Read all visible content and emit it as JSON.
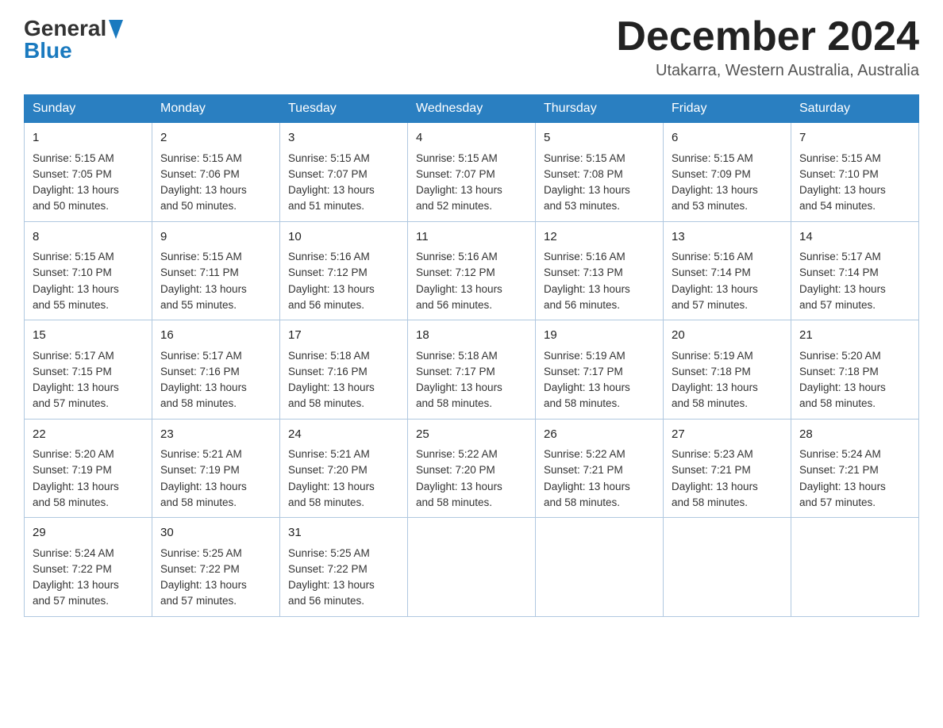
{
  "header": {
    "logo_general": "General",
    "logo_blue": "Blue",
    "month_title": "December 2024",
    "subtitle": "Utakarra, Western Australia, Australia"
  },
  "days_of_week": [
    "Sunday",
    "Monday",
    "Tuesday",
    "Wednesday",
    "Thursday",
    "Friday",
    "Saturday"
  ],
  "weeks": [
    {
      "days": [
        {
          "num": "1",
          "sunrise": "5:15 AM",
          "sunset": "7:05 PM",
          "daylight": "13 hours and 50 minutes."
        },
        {
          "num": "2",
          "sunrise": "5:15 AM",
          "sunset": "7:06 PM",
          "daylight": "13 hours and 50 minutes."
        },
        {
          "num": "3",
          "sunrise": "5:15 AM",
          "sunset": "7:07 PM",
          "daylight": "13 hours and 51 minutes."
        },
        {
          "num": "4",
          "sunrise": "5:15 AM",
          "sunset": "7:07 PM",
          "daylight": "13 hours and 52 minutes."
        },
        {
          "num": "5",
          "sunrise": "5:15 AM",
          "sunset": "7:08 PM",
          "daylight": "13 hours and 53 minutes."
        },
        {
          "num": "6",
          "sunrise": "5:15 AM",
          "sunset": "7:09 PM",
          "daylight": "13 hours and 53 minutes."
        },
        {
          "num": "7",
          "sunrise": "5:15 AM",
          "sunset": "7:10 PM",
          "daylight": "13 hours and 54 minutes."
        }
      ]
    },
    {
      "days": [
        {
          "num": "8",
          "sunrise": "5:15 AM",
          "sunset": "7:10 PM",
          "daylight": "13 hours and 55 minutes."
        },
        {
          "num": "9",
          "sunrise": "5:15 AM",
          "sunset": "7:11 PM",
          "daylight": "13 hours and 55 minutes."
        },
        {
          "num": "10",
          "sunrise": "5:16 AM",
          "sunset": "7:12 PM",
          "daylight": "13 hours and 56 minutes."
        },
        {
          "num": "11",
          "sunrise": "5:16 AM",
          "sunset": "7:12 PM",
          "daylight": "13 hours and 56 minutes."
        },
        {
          "num": "12",
          "sunrise": "5:16 AM",
          "sunset": "7:13 PM",
          "daylight": "13 hours and 56 minutes."
        },
        {
          "num": "13",
          "sunrise": "5:16 AM",
          "sunset": "7:14 PM",
          "daylight": "13 hours and 57 minutes."
        },
        {
          "num": "14",
          "sunrise": "5:17 AM",
          "sunset": "7:14 PM",
          "daylight": "13 hours and 57 minutes."
        }
      ]
    },
    {
      "days": [
        {
          "num": "15",
          "sunrise": "5:17 AM",
          "sunset": "7:15 PM",
          "daylight": "13 hours and 57 minutes."
        },
        {
          "num": "16",
          "sunrise": "5:17 AM",
          "sunset": "7:16 PM",
          "daylight": "13 hours and 58 minutes."
        },
        {
          "num": "17",
          "sunrise": "5:18 AM",
          "sunset": "7:16 PM",
          "daylight": "13 hours and 58 minutes."
        },
        {
          "num": "18",
          "sunrise": "5:18 AM",
          "sunset": "7:17 PM",
          "daylight": "13 hours and 58 minutes."
        },
        {
          "num": "19",
          "sunrise": "5:19 AM",
          "sunset": "7:17 PM",
          "daylight": "13 hours and 58 minutes."
        },
        {
          "num": "20",
          "sunrise": "5:19 AM",
          "sunset": "7:18 PM",
          "daylight": "13 hours and 58 minutes."
        },
        {
          "num": "21",
          "sunrise": "5:20 AM",
          "sunset": "7:18 PM",
          "daylight": "13 hours and 58 minutes."
        }
      ]
    },
    {
      "days": [
        {
          "num": "22",
          "sunrise": "5:20 AM",
          "sunset": "7:19 PM",
          "daylight": "13 hours and 58 minutes."
        },
        {
          "num": "23",
          "sunrise": "5:21 AM",
          "sunset": "7:19 PM",
          "daylight": "13 hours and 58 minutes."
        },
        {
          "num": "24",
          "sunrise": "5:21 AM",
          "sunset": "7:20 PM",
          "daylight": "13 hours and 58 minutes."
        },
        {
          "num": "25",
          "sunrise": "5:22 AM",
          "sunset": "7:20 PM",
          "daylight": "13 hours and 58 minutes."
        },
        {
          "num": "26",
          "sunrise": "5:22 AM",
          "sunset": "7:21 PM",
          "daylight": "13 hours and 58 minutes."
        },
        {
          "num": "27",
          "sunrise": "5:23 AM",
          "sunset": "7:21 PM",
          "daylight": "13 hours and 58 minutes."
        },
        {
          "num": "28",
          "sunrise": "5:24 AM",
          "sunset": "7:21 PM",
          "daylight": "13 hours and 57 minutes."
        }
      ]
    },
    {
      "days": [
        {
          "num": "29",
          "sunrise": "5:24 AM",
          "sunset": "7:22 PM",
          "daylight": "13 hours and 57 minutes."
        },
        {
          "num": "30",
          "sunrise": "5:25 AM",
          "sunset": "7:22 PM",
          "daylight": "13 hours and 57 minutes."
        },
        {
          "num": "31",
          "sunrise": "5:25 AM",
          "sunset": "7:22 PM",
          "daylight": "13 hours and 56 minutes."
        },
        null,
        null,
        null,
        null
      ]
    }
  ],
  "labels": {
    "sunrise": "Sunrise:",
    "sunset": "Sunset:",
    "daylight": "Daylight:"
  }
}
